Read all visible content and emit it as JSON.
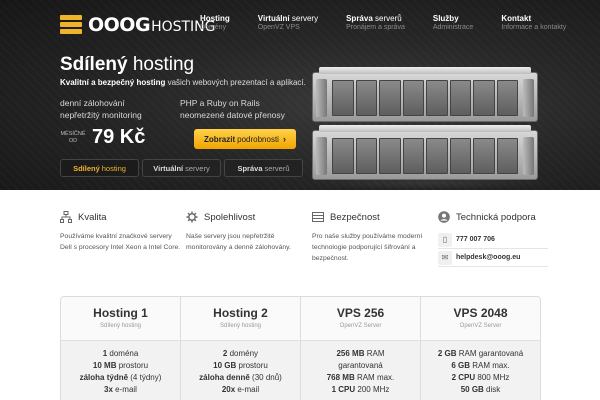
{
  "logo": {
    "main": "OOOG",
    "suffix": "HOSTING"
  },
  "nav": [
    {
      "title_bold": "Hosting",
      "title_rest": "",
      "sub": "Domény"
    },
    {
      "title_bold": "Virtuální",
      "title_rest": " servery",
      "sub": "OpenVZ VPS"
    },
    {
      "title_bold": "Správa",
      "title_rest": " serverů",
      "sub": "Pronájem a správa"
    },
    {
      "title_bold": "Služby",
      "title_rest": "",
      "sub": "Administrace"
    },
    {
      "title_bold": "Kontakt",
      "title_rest": "",
      "sub": "Informace a kontakty"
    }
  ],
  "hero": {
    "title_bold": "Sdílený",
    "title_rest": " hosting",
    "sub_bold": "Kvalitní a bezpečný hosting",
    "sub_rest": " vašich webových prezentací a aplikací.",
    "features_left": [
      "denní zálohování",
      "nepřetržitý monitoring"
    ],
    "features_right": [
      "PHP a Ruby on Rails",
      "neomezené datové přenosy"
    ],
    "price_pre_1": "MĚSÍČNĚ",
    "price_pre_2": "OD",
    "price": "79 Kč",
    "cta_bold": "Zobrazit",
    "cta_rest": "podrobnosti",
    "cta_arrow": "›",
    "tabs": [
      {
        "bold": "Sdílený",
        "rest": "hosting"
      },
      {
        "bold": "Virtuální",
        "rest": "servery"
      },
      {
        "bold": "Správa",
        "rest": "serverů"
      }
    ]
  },
  "features": [
    {
      "icon": "network-icon",
      "title": "Kvalita",
      "text": "Používáme kvalitní značkové servery Dell s procesory Intel Xeon a Intel Core."
    },
    {
      "icon": "gear-icon",
      "title": "Spolehlivost",
      "text": "Naše servery jsou nepřetržitě monitorovány a denně zálohovány."
    },
    {
      "icon": "server-icon",
      "title": "Bezpečnost",
      "text": "Pro naše služby používáme moderní technologie podporující šifrování a bezpečnost."
    },
    {
      "icon": "user-icon",
      "title": "Technická podpora",
      "phone": "777 007 706",
      "email": "helpdesk@ooog.eu"
    }
  ],
  "plans": [
    {
      "name": "Hosting 1",
      "sub": "Sdílený hosting",
      "rows": [
        [
          "1",
          " doména"
        ],
        [
          "10 MB",
          " prostoru"
        ],
        [
          "záloha týdně",
          " (4 týdny)"
        ],
        [
          "3x",
          " e-mail"
        ]
      ]
    },
    {
      "name": "Hosting 2",
      "sub": "Sdílený hosting",
      "rows": [
        [
          "2",
          " domény"
        ],
        [
          "10 GB",
          " prostoru"
        ],
        [
          "záloha denně",
          " (30 dnů)"
        ],
        [
          "20x",
          " e-mail"
        ]
      ]
    },
    {
      "name": "VPS 256",
      "sub": "OpenVZ Server",
      "rows": [
        [
          "256 MB",
          " RAM"
        ],
        [
          "",
          "garantovaná"
        ],
        [
          "768 MB",
          " RAM max."
        ],
        [
          "1 CPU",
          " 200 MHz"
        ]
      ]
    },
    {
      "name": "VPS 2048",
      "sub": "OpenVZ Server",
      "rows": [
        [
          "2 GB",
          " RAM garantovaná"
        ],
        [
          "6 GB",
          " RAM max."
        ],
        [
          "2 CPU",
          " 800 MHz"
        ],
        [
          "50 GB",
          " disk"
        ]
      ]
    }
  ],
  "colors": {
    "accent": "#f0b429",
    "hero_bg": "#222222",
    "cta": "#ffc42a"
  }
}
